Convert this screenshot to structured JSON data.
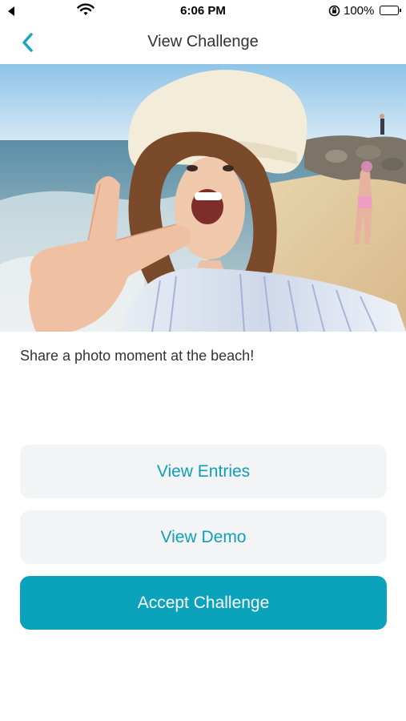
{
  "status_bar": {
    "time": "6:06 PM",
    "battery_percent": "100%",
    "icons": [
      "back-arrow-icon",
      "wifi-icon",
      "orientation-lock-icon",
      "battery-icon"
    ]
  },
  "nav": {
    "title": "View Challenge",
    "back_icon": "chevron-left-icon"
  },
  "challenge": {
    "description": "Share a photo moment at the beach!"
  },
  "actions": {
    "view_entries": "View Entries",
    "view_demo": "View Demo",
    "accept": "Accept Challenge"
  },
  "colors": {
    "accent": "#0ba3bc",
    "accent_text": "#0f9fb8",
    "secondary_button_bg": "#f3f4f6"
  }
}
